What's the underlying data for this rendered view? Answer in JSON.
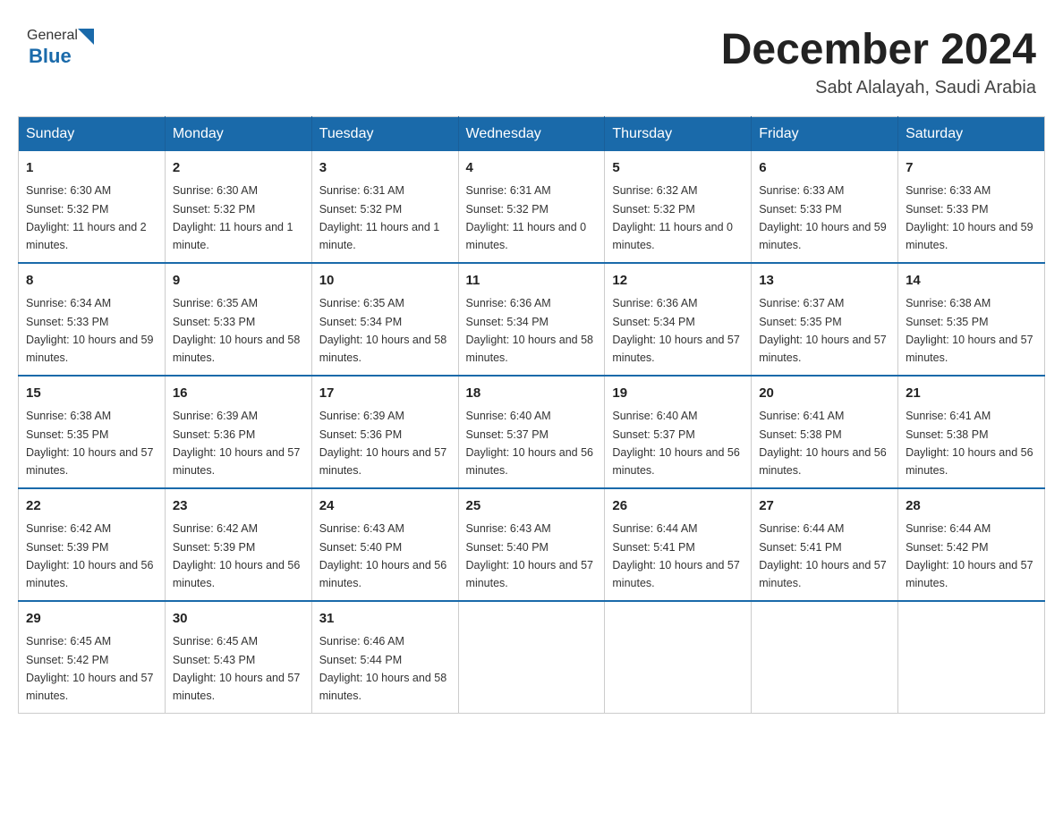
{
  "header": {
    "logo_general": "General",
    "logo_blue": "Blue",
    "month_title": "December 2024",
    "location": "Sabt Alalayah, Saudi Arabia"
  },
  "days_of_week": [
    "Sunday",
    "Monday",
    "Tuesday",
    "Wednesday",
    "Thursday",
    "Friday",
    "Saturday"
  ],
  "weeks": [
    [
      {
        "day": "1",
        "sunrise": "6:30 AM",
        "sunset": "5:32 PM",
        "daylight": "11 hours and 2 minutes."
      },
      {
        "day": "2",
        "sunrise": "6:30 AM",
        "sunset": "5:32 PM",
        "daylight": "11 hours and 1 minute."
      },
      {
        "day": "3",
        "sunrise": "6:31 AM",
        "sunset": "5:32 PM",
        "daylight": "11 hours and 1 minute."
      },
      {
        "day": "4",
        "sunrise": "6:31 AM",
        "sunset": "5:32 PM",
        "daylight": "11 hours and 0 minutes."
      },
      {
        "day": "5",
        "sunrise": "6:32 AM",
        "sunset": "5:32 PM",
        "daylight": "11 hours and 0 minutes."
      },
      {
        "day": "6",
        "sunrise": "6:33 AM",
        "sunset": "5:33 PM",
        "daylight": "10 hours and 59 minutes."
      },
      {
        "day": "7",
        "sunrise": "6:33 AM",
        "sunset": "5:33 PM",
        "daylight": "10 hours and 59 minutes."
      }
    ],
    [
      {
        "day": "8",
        "sunrise": "6:34 AM",
        "sunset": "5:33 PM",
        "daylight": "10 hours and 59 minutes."
      },
      {
        "day": "9",
        "sunrise": "6:35 AM",
        "sunset": "5:33 PM",
        "daylight": "10 hours and 58 minutes."
      },
      {
        "day": "10",
        "sunrise": "6:35 AM",
        "sunset": "5:34 PM",
        "daylight": "10 hours and 58 minutes."
      },
      {
        "day": "11",
        "sunrise": "6:36 AM",
        "sunset": "5:34 PM",
        "daylight": "10 hours and 58 minutes."
      },
      {
        "day": "12",
        "sunrise": "6:36 AM",
        "sunset": "5:34 PM",
        "daylight": "10 hours and 57 minutes."
      },
      {
        "day": "13",
        "sunrise": "6:37 AM",
        "sunset": "5:35 PM",
        "daylight": "10 hours and 57 minutes."
      },
      {
        "day": "14",
        "sunrise": "6:38 AM",
        "sunset": "5:35 PM",
        "daylight": "10 hours and 57 minutes."
      }
    ],
    [
      {
        "day": "15",
        "sunrise": "6:38 AM",
        "sunset": "5:35 PM",
        "daylight": "10 hours and 57 minutes."
      },
      {
        "day": "16",
        "sunrise": "6:39 AM",
        "sunset": "5:36 PM",
        "daylight": "10 hours and 57 minutes."
      },
      {
        "day": "17",
        "sunrise": "6:39 AM",
        "sunset": "5:36 PM",
        "daylight": "10 hours and 57 minutes."
      },
      {
        "day": "18",
        "sunrise": "6:40 AM",
        "sunset": "5:37 PM",
        "daylight": "10 hours and 56 minutes."
      },
      {
        "day": "19",
        "sunrise": "6:40 AM",
        "sunset": "5:37 PM",
        "daylight": "10 hours and 56 minutes."
      },
      {
        "day": "20",
        "sunrise": "6:41 AM",
        "sunset": "5:38 PM",
        "daylight": "10 hours and 56 minutes."
      },
      {
        "day": "21",
        "sunrise": "6:41 AM",
        "sunset": "5:38 PM",
        "daylight": "10 hours and 56 minutes."
      }
    ],
    [
      {
        "day": "22",
        "sunrise": "6:42 AM",
        "sunset": "5:39 PM",
        "daylight": "10 hours and 56 minutes."
      },
      {
        "day": "23",
        "sunrise": "6:42 AM",
        "sunset": "5:39 PM",
        "daylight": "10 hours and 56 minutes."
      },
      {
        "day": "24",
        "sunrise": "6:43 AM",
        "sunset": "5:40 PM",
        "daylight": "10 hours and 56 minutes."
      },
      {
        "day": "25",
        "sunrise": "6:43 AM",
        "sunset": "5:40 PM",
        "daylight": "10 hours and 57 minutes."
      },
      {
        "day": "26",
        "sunrise": "6:44 AM",
        "sunset": "5:41 PM",
        "daylight": "10 hours and 57 minutes."
      },
      {
        "day": "27",
        "sunrise": "6:44 AM",
        "sunset": "5:41 PM",
        "daylight": "10 hours and 57 minutes."
      },
      {
        "day": "28",
        "sunrise": "6:44 AM",
        "sunset": "5:42 PM",
        "daylight": "10 hours and 57 minutes."
      }
    ],
    [
      {
        "day": "29",
        "sunrise": "6:45 AM",
        "sunset": "5:42 PM",
        "daylight": "10 hours and 57 minutes."
      },
      {
        "day": "30",
        "sunrise": "6:45 AM",
        "sunset": "5:43 PM",
        "daylight": "10 hours and 57 minutes."
      },
      {
        "day": "31",
        "sunrise": "6:46 AM",
        "sunset": "5:44 PM",
        "daylight": "10 hours and 58 minutes."
      },
      null,
      null,
      null,
      null
    ]
  ]
}
